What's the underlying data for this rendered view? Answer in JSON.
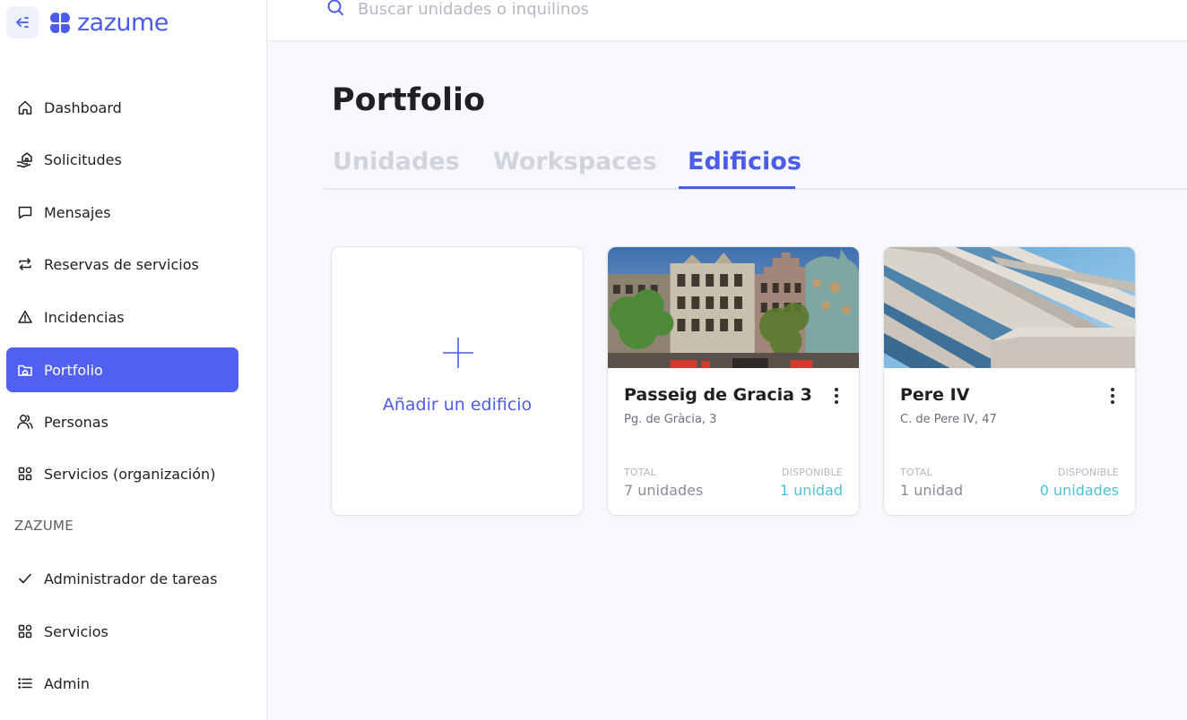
{
  "brand": {
    "name": "zazume",
    "color": "#4c5ce6"
  },
  "search": {
    "placeholder": "Buscar unidades o inquilinos"
  },
  "sidebar": {
    "items": [
      {
        "label": "Dashboard",
        "icon": "home-icon"
      },
      {
        "label": "Solicitudes",
        "icon": "hand-house-icon"
      },
      {
        "label": "Mensajes",
        "icon": "chat-bubble-icon"
      },
      {
        "label": "Reservas de servicios",
        "icon": "repeat-icon"
      },
      {
        "label": "Incidencias",
        "icon": "warning-icon"
      },
      {
        "label": "Portfolio",
        "icon": "folder-home-icon",
        "active": true
      },
      {
        "label": "Personas",
        "icon": "people-icon"
      },
      {
        "label": "Servicios (organización)",
        "icon": "grid-icon"
      }
    ],
    "section_title": "ZAZUME",
    "section_items": [
      {
        "label": "Administrador de tareas",
        "icon": "check-icon"
      },
      {
        "label": "Servicios",
        "icon": "grid-icon"
      },
      {
        "label": "Admin",
        "icon": "list-icon"
      }
    ]
  },
  "main": {
    "title": "Portfolio",
    "tabs": [
      {
        "label": "Unidades"
      },
      {
        "label": "Workspaces"
      },
      {
        "label": "Edificios",
        "active": true
      }
    ],
    "add_card": {
      "label": "Añadir un edificio"
    },
    "buildings": [
      {
        "name": "Passeig de Gracia 3",
        "address": "Pg. de Gràcia, 3",
        "total_caption": "TOTAL",
        "total_value": "7 unidades",
        "available_caption": "DISPONIBLE",
        "available_value": "1 unidad"
      },
      {
        "name": "Pere IV",
        "address": "C. de Pere IV, 47",
        "total_caption": "TOTAL",
        "total_value": "1 unidad",
        "available_caption": "DISPONIBLE",
        "available_value": "0 unidades"
      }
    ]
  },
  "colors": {
    "accent": "#5160f0",
    "available": "#4bc3d6"
  }
}
